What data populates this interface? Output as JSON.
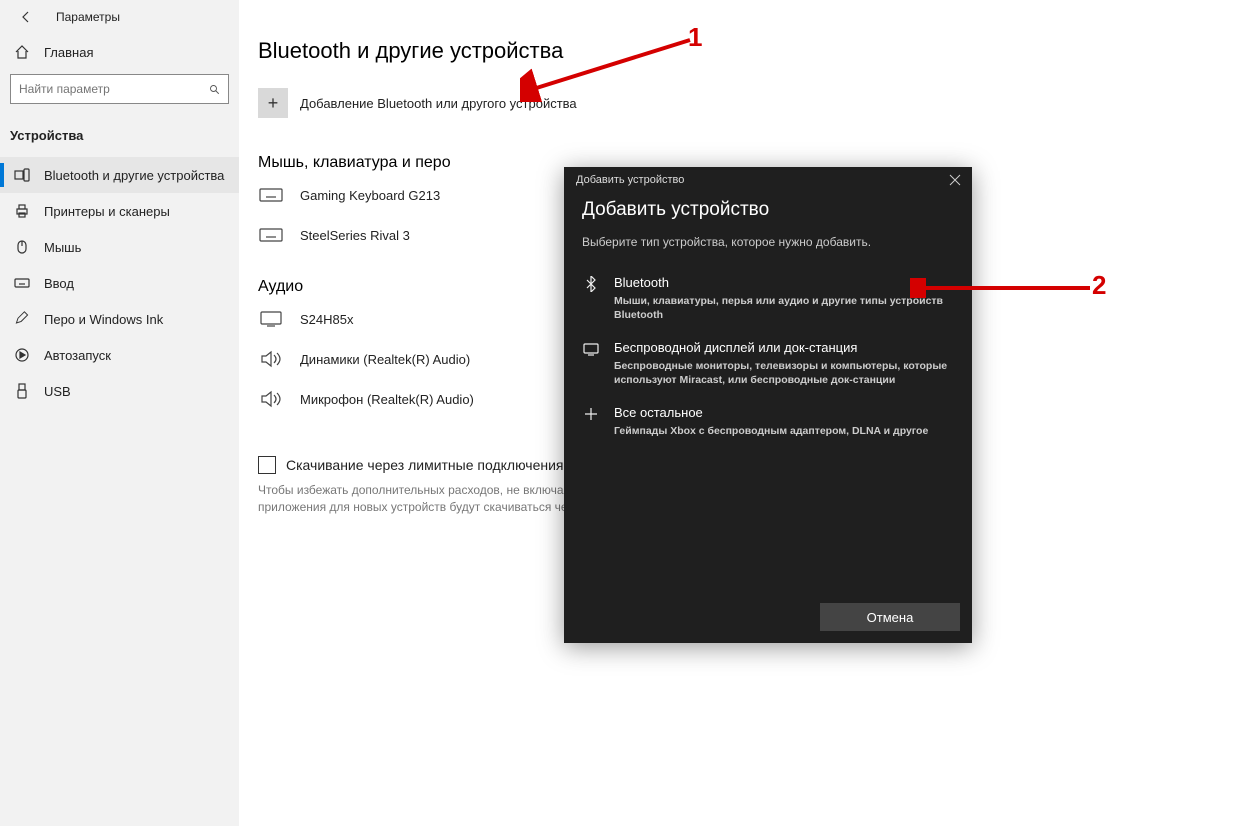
{
  "sidebar": {
    "back_label": "Параметры",
    "home_label": "Главная",
    "search_placeholder": "Найти параметр",
    "section_title": "Устройства",
    "items": [
      {
        "label": "Bluetooth и другие устройства",
        "icon": "bluetooth-devices"
      },
      {
        "label": "Принтеры и сканеры",
        "icon": "printer"
      },
      {
        "label": "Мышь",
        "icon": "mouse"
      },
      {
        "label": "Ввод",
        "icon": "keyboard"
      },
      {
        "label": "Перо и Windows Ink",
        "icon": "pen"
      },
      {
        "label": "Автозапуск",
        "icon": "autoplay"
      },
      {
        "label": "USB",
        "icon": "usb"
      }
    ]
  },
  "main": {
    "title": "Bluetooth и другие устройства",
    "add_label": "Добавление Bluetooth или другого устройства",
    "section_mouse": "Мышь, клавиатура и перо",
    "device_keyboard": "Gaming Keyboard G213",
    "device_mouse": "SteelSeries Rival 3",
    "section_audio": "Аудио",
    "device_monitor": "S24H85x",
    "device_speakers": "Динамики (Realtek(R) Audio)",
    "device_microphone": "Микрофон (Realtek(R) Audio)",
    "checkbox_label": "Скачивание через лимитные подключения",
    "hint_text": "Чтобы избежать дополнительных расходов, не включайте этот параметр. Драйверы, данные и приложения для новых устройств будут скачиваться через лимитные подключения к Интернету."
  },
  "dialog": {
    "title_bar": "Добавить устройство",
    "heading": "Добавить устройство",
    "subheading": "Выберите тип устройства, которое нужно добавить.",
    "options": [
      {
        "title": "Bluetooth",
        "desc": "Мыши, клавиатуры, перья или аудио и другие типы устройств Bluetooth"
      },
      {
        "title": "Беспроводной дисплей или док-станция",
        "desc": "Беспроводные мониторы, телевизоры и компьютеры, которые используют Miracast, или беспроводные док-станции"
      },
      {
        "title": "Все остальное",
        "desc": "Геймпады Xbox с беспроводным адаптером, DLNA и другое"
      }
    ],
    "cancel_label": "Отмена"
  },
  "annotations": {
    "num1": "1",
    "num2": "2"
  }
}
